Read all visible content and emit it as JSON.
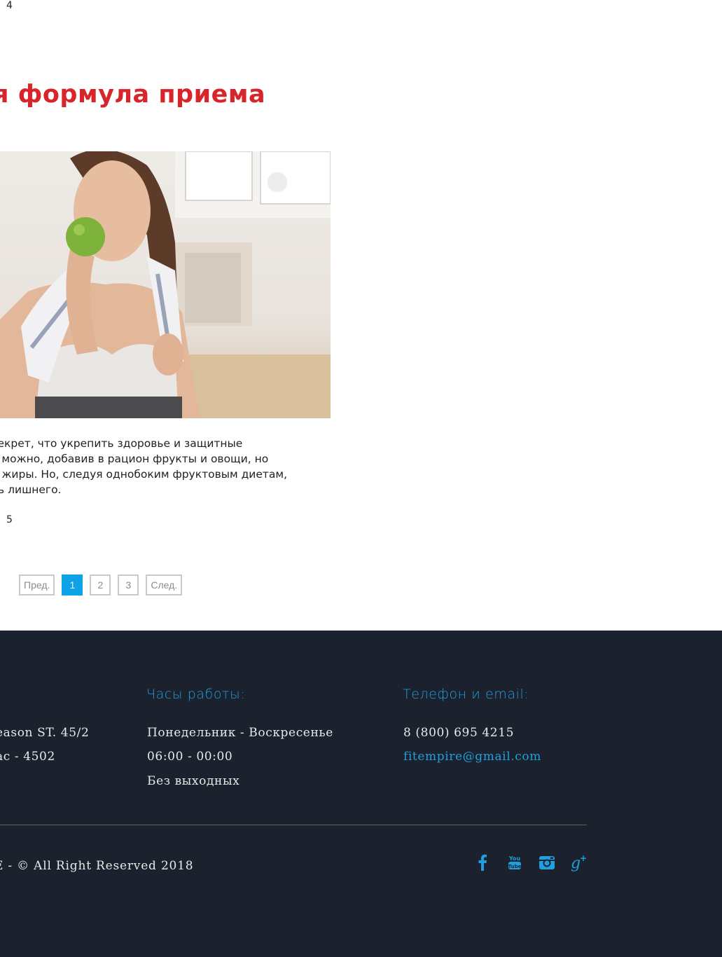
{
  "counters": {
    "top": "4",
    "bottom": "5"
  },
  "article": {
    "title": "я формула приема",
    "image_alt": "Девушка ест зелёное яблоко",
    "excerpt_lines": [
      "секрет, что укрепить здоровье и защитные",
      "а можно, добавив в рацион фрукты и овощи, но",
      "е жиры. Но, следуя однобоким фруктовым диетам,",
      "ть лишнего."
    ]
  },
  "pagination": {
    "prev": "Пред.",
    "pages": [
      "1",
      "2",
      "3"
    ],
    "active_page": "1",
    "next": "След."
  },
  "footer": {
    "address_lines": [
      "eason ST. 45/2",
      "ас - 4502"
    ],
    "hours": {
      "heading": "Часы работы:",
      "lines": [
        "Понедельник - Воскресенье",
        "06:00 - 00:00",
        "Без выходных"
      ]
    },
    "contacts": {
      "heading": "Телефон и email:",
      "phone": "8 (800) 695 4215",
      "email": "fitempire@gmail.com"
    },
    "copyright": "E -  © All Right Reserved 2018",
    "social": [
      {
        "name": "facebook-icon",
        "glyph": "f"
      },
      {
        "name": "youtube-icon",
        "glyph": "You Tube"
      },
      {
        "name": "instagram-icon",
        "glyph": ""
      },
      {
        "name": "google-plus-icon",
        "glyph": "g+"
      }
    ]
  },
  "colors": {
    "accent_red": "#d7252b",
    "accent_blue": "#1e9fe0",
    "footer_bg": "#1b222d",
    "page_active": "#0ea3e6"
  }
}
